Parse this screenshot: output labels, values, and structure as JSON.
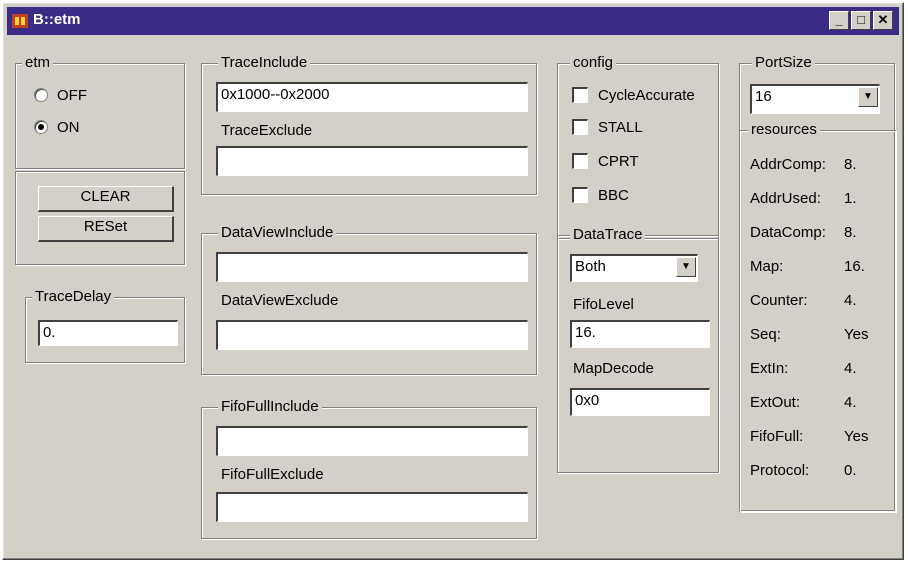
{
  "window": {
    "title": "B::etm"
  },
  "etm": {
    "legend": "etm",
    "options": [
      "OFF",
      "ON"
    ],
    "selected": "ON",
    "clear_label": "CLEAR",
    "reset_label": "RESet"
  },
  "trace_delay": {
    "legend": "TraceDelay",
    "value": "0."
  },
  "trace_include": {
    "legend": "TraceInclude",
    "value": "0x1000--0x2000"
  },
  "trace_exclude": {
    "legend": "TraceExclude",
    "value": ""
  },
  "dataview_include": {
    "legend": "DataViewInclude",
    "value": ""
  },
  "dataview_exclude": {
    "legend": "DataViewExclude",
    "value": ""
  },
  "fifofull_include": {
    "legend": "FifoFullInclude",
    "value": ""
  },
  "fifofull_exclude": {
    "legend": "FifoFullExclude",
    "value": ""
  },
  "config": {
    "legend": "config",
    "checks": [
      "CycleAccurate",
      "STALL",
      "CPRT",
      "BBC"
    ]
  },
  "datatrace": {
    "legend": "DataTrace",
    "value": "Both"
  },
  "fifolevel": {
    "legend": "FifoLevel",
    "value": "16."
  },
  "mapdecode": {
    "legend": "MapDecode",
    "value": "0x0"
  },
  "portsize": {
    "legend": "PortSize",
    "value": "16"
  },
  "resources": {
    "legend": "resources",
    "rows": [
      {
        "label": "AddrComp:",
        "value": "8."
      },
      {
        "label": "AddrUsed:",
        "value": "1."
      },
      {
        "label": "DataComp:",
        "value": "8."
      },
      {
        "label": "Map:",
        "value": "16."
      },
      {
        "label": "Counter:",
        "value": "4."
      },
      {
        "label": "Seq:",
        "value": "Yes"
      },
      {
        "label": "ExtIn:",
        "value": "4."
      },
      {
        "label": "ExtOut:",
        "value": "4."
      },
      {
        "label": "FifoFull:",
        "value": "Yes"
      },
      {
        "label": "Protocol:",
        "value": "0."
      }
    ]
  },
  "titlebar_buttons": {
    "minimize": "_",
    "maximize": "□",
    "close": "✕"
  },
  "dropdown_arrow": "▼",
  "colors": {
    "titlebar": "#3b2b86",
    "face": "#d4d0c8"
  }
}
